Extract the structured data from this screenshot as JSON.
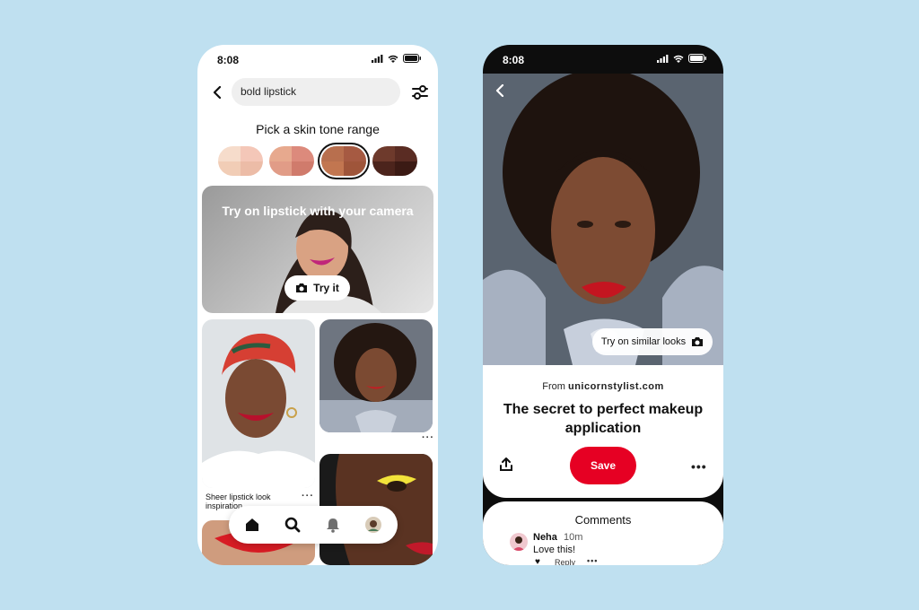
{
  "left_phone": {
    "status_time": "8:08",
    "search": {
      "value": "bold lipstick"
    },
    "skin_tone_title": "Pick a skin tone range",
    "skin_tones": [
      {
        "colors": [
          "#f6dccb",
          "#f4c7b8",
          "#f1cdb6",
          "#ecbca7"
        ],
        "selected": false
      },
      {
        "colors": [
          "#e7a98e",
          "#dc8a7c",
          "#e19c87",
          "#d07b6c"
        ],
        "selected": false
      },
      {
        "colors": [
          "#b86f4e",
          "#a65a42",
          "#c27650",
          "#9f553a"
        ],
        "selected": true
      },
      {
        "colors": [
          "#6e3a2c",
          "#5a2c23",
          "#4c241c",
          "#3b1a14"
        ],
        "selected": false
      }
    ],
    "tryon_banner": {
      "text": "Try on lipstick with your camera",
      "button_label": "Try it"
    },
    "pins": [
      {
        "caption": "Sheer lipstick look inspiration",
        "more": "···"
      },
      {
        "more": "···"
      }
    ],
    "nav": {
      "icons": [
        "home-icon",
        "search-icon",
        "bell-icon",
        "profile-avatar"
      ]
    }
  },
  "right_phone": {
    "status_time": "8:08",
    "similar_button_label": "Try on similar looks",
    "source_prefix": "From",
    "source_domain": "unicornstylist.com",
    "title": "The secret to perfect makeup application",
    "save_label": "Save",
    "more_label": "•••",
    "comments": {
      "title": "Comments",
      "items": [
        {
          "author": "Neha",
          "time": "10m",
          "text": "Love this!",
          "reply_label": "Reply",
          "more": "•••"
        }
      ]
    }
  },
  "colors": {
    "background": "#bfe0f0",
    "save_red": "#e60023",
    "phone_dark": "#0d0d0d"
  }
}
